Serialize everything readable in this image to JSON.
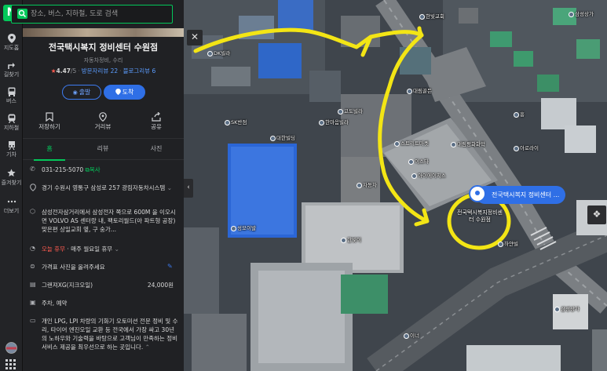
{
  "rail": {
    "items": [
      {
        "icon": "pin",
        "label": "지도홈"
      },
      {
        "icon": "route",
        "label": "길찾기"
      },
      {
        "icon": "bus",
        "label": "버스"
      },
      {
        "icon": "subway",
        "label": "지하철"
      },
      {
        "icon": "train",
        "label": "기차"
      },
      {
        "icon": "star",
        "label": "즐겨찾기"
      },
      {
        "icon": "more",
        "label": "더보기"
      }
    ]
  },
  "search": {
    "placeholder": "장소, 버스, 지하철, 도로 검색"
  },
  "place": {
    "name": "전국택시복지 정비센터 수원점",
    "category": "자동차정비, 수리",
    "rating_value": "4.47",
    "rating_max": "/5",
    "visitor_reviews": "방문자리뷰 22",
    "blog_reviews": "블로그리뷰 6"
  },
  "buttons": {
    "depart": "출발",
    "arrive": "도착"
  },
  "actions": {
    "save": "저장하기",
    "distance": "거리뷰",
    "share": "공유"
  },
  "tabs": [
    {
      "label": "홈",
      "active": true
    },
    {
      "label": "리뷰",
      "active": false
    },
    {
      "label": "사진",
      "active": false
    }
  ],
  "info": {
    "phone": "031-215-5070",
    "copy": "복사",
    "address": "경기 수원시 영통구 삼성로 257 광림자동차시스템",
    "directions": "삼성전자삼거리에서 삼성전자 쪽으로 600M 을 이오시면 VOLVO AS 센터랑 내, 팩토리월드(아 파트형 공장) 맞은편 상일교회 옆, 구 숭가...",
    "closed_label": "오늘 휴무",
    "closed_detail": "· 매주 월요일 휴무",
    "price_prompt": "가격표 사진을 올려주세요",
    "price_item": "그랜져XG(지크오일)",
    "price_value": "24,000원",
    "amenities": "주차, 예약",
    "description": "개인 LPG, LPI 차량의 기화기 오토미션 전문 정비 및 수리, 타이어 엔진오일 교환 등 전국에서 가장 싸고 30년의 노하우와 기술력을 바탕으로 고객님이 만족하는 정비서비스 제공을 최우선으로 하는 곳입니다."
  },
  "map": {
    "selected_tag": "전국택시복지 정비센터 ...",
    "selected_label": "전국택시복지정비센터 수원점",
    "labels": [
      {
        "text": "DK빌라"
      },
      {
        "text": "대림골든"
      },
      {
        "text": "고도빌라"
      },
      {
        "text": "한마음빌라"
      },
      {
        "text": "SK반점"
      },
      {
        "text": "스트리트마켓"
      },
      {
        "text": "이스타"
      },
      {
        "text": "대림평화화학"
      },
      {
        "text": "아이에이치스"
      },
      {
        "text": "성모이발"
      },
      {
        "text": "아로라이"
      },
      {
        "text": "삼성상가"
      },
      {
        "text": "대한빌딩"
      },
      {
        "text": "한빛이"
      },
      {
        "text": "한빛교회"
      },
      {
        "text": "삼성상가"
      },
      {
        "text": "흥"
      },
      {
        "text": "자동차"
      },
      {
        "text": "이너"
      },
      {
        "text": "하얀빌"
      }
    ]
  }
}
